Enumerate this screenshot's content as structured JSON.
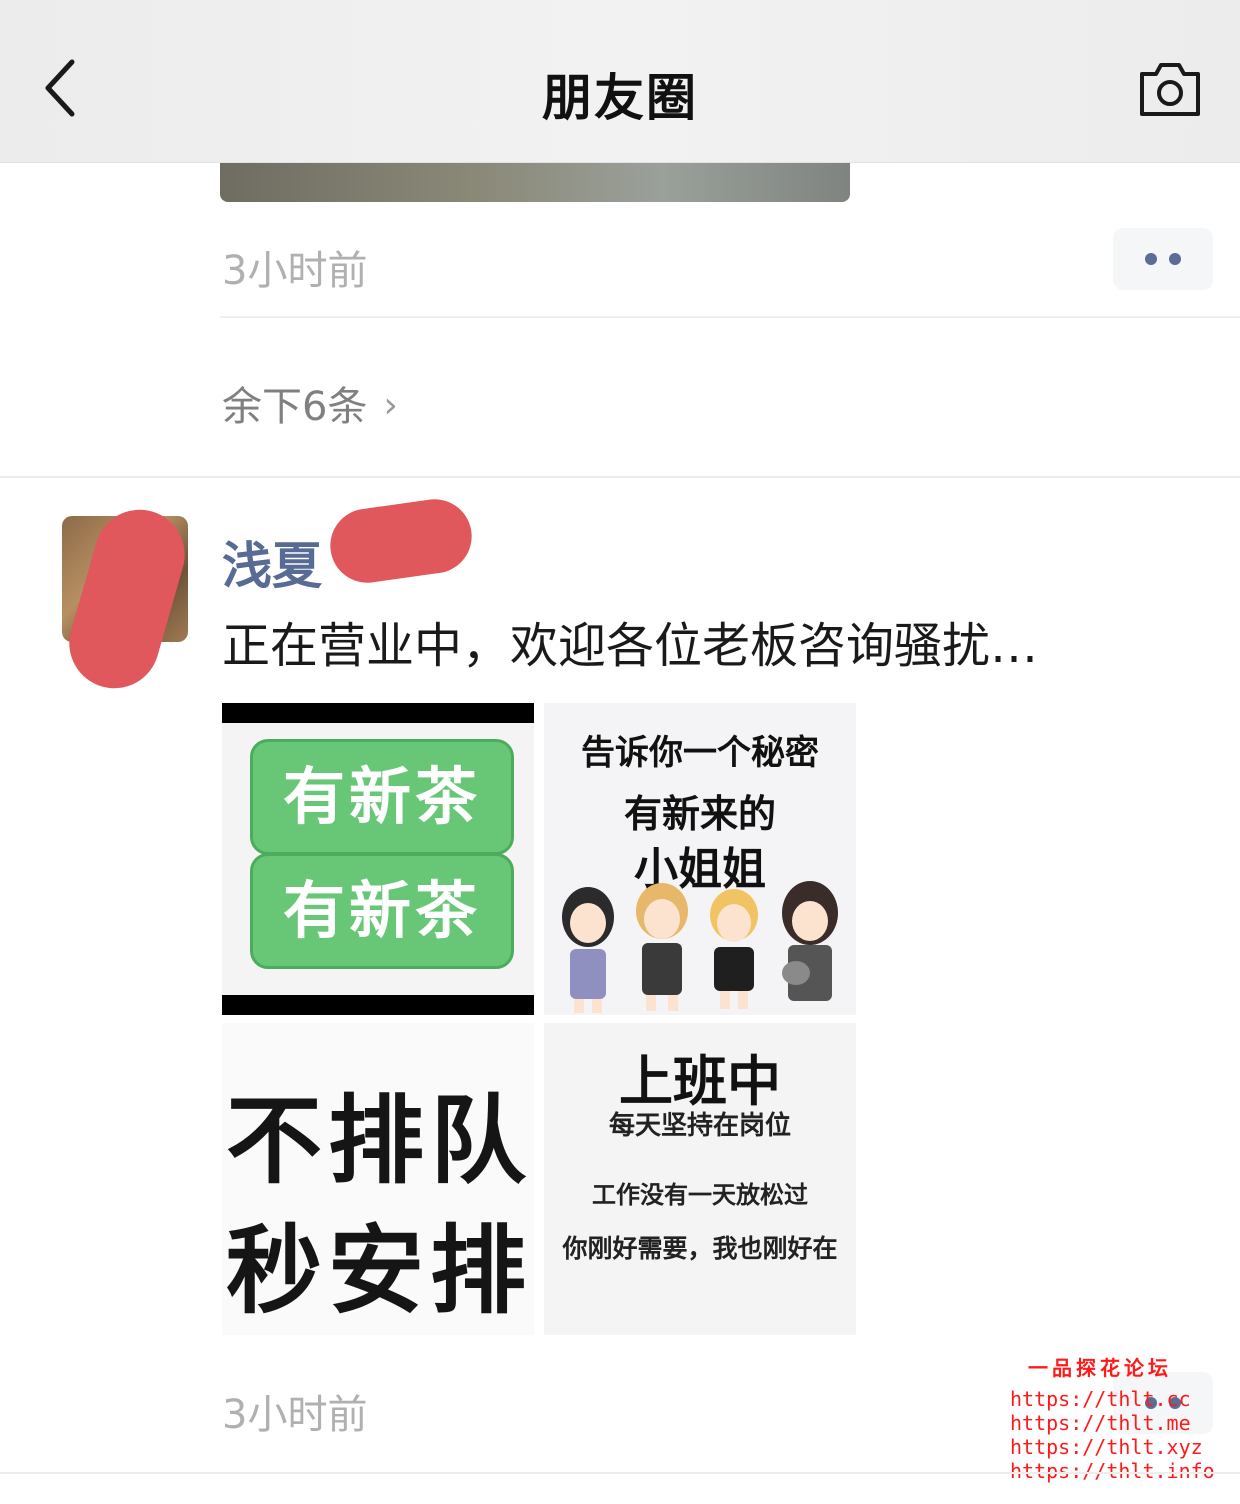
{
  "header": {
    "title": "朋友圈",
    "back_icon": "chevron-left-icon",
    "camera_icon": "camera-icon"
  },
  "prev_post": {
    "time": "3小时前",
    "remaining": "余下6条",
    "remaining_chevron": "›"
  },
  "post": {
    "username": "浅夏",
    "text": "正在营业中，欢迎各位老板咨询骚扰…",
    "time": "3小时前",
    "images": [
      {
        "lines": [
          "有新茶",
          "有新茶"
        ]
      },
      {
        "lines": [
          "告诉你一个秘密",
          "有新来的",
          "小姐姐"
        ]
      },
      {
        "lines": [
          "不排队",
          "秒安排"
        ]
      },
      {
        "lines": [
          "上班中",
          "每天坚持在岗位",
          "工作没有一天放松过",
          "你刚好需要，我也刚好在"
        ]
      }
    ]
  },
  "watermark": {
    "title": "一品探花论坛",
    "lines": [
      "https://thlt.cc",
      "https://thlt.me",
      "https://thlt.xyz",
      "https://thlt.info"
    ]
  },
  "colors": {
    "username": "#576b95",
    "redaction": "#e0575c",
    "watermark": "#ff1a1a",
    "tea_green": "#67c777"
  }
}
